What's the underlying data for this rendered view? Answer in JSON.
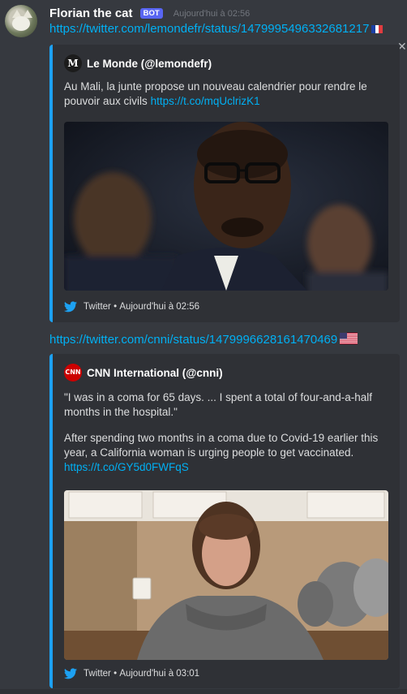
{
  "message": {
    "author": "Florian the cat",
    "bot_tag": "BOT",
    "timestamp": "Aujourd'hui à 02:56"
  },
  "links": [
    {
      "url": "https://twitter.com/lemondefr/status/1479995496332681217",
      "flag": "fr"
    },
    {
      "url": "https://twitter.com/cnni/status/1479996628161470469",
      "flag": "us"
    }
  ],
  "embeds": [
    {
      "author_name": "Le Monde (@lemondefr)",
      "author_icon": "lemonde-logo-icon",
      "author_icon_text": "M",
      "description_text": "Au Mali, la junte propose un nouveau calendrier pour rendre le pouvoir aux civils",
      "description_link": "https://t.co/mqUclrizK1",
      "footer_source": "Twitter",
      "footer_sep": "•",
      "footer_time": "Aujourd'hui à 02:56",
      "accent_color": "#1da1f2"
    },
    {
      "author_name": "CNN International (@cnni)",
      "author_icon": "cnn-logo-icon",
      "author_icon_text": "CNN",
      "description_p1": "\"I was in a coma for 65 days. ... I spent a total of four-and-a-half months in the hospital.\"",
      "description_p2": "After spending two months in a coma due to Covid-19 earlier this year, a California woman is urging people to get vaccinated.",
      "description_link": "https://t.co/GY5d0FWFqS",
      "footer_source": "Twitter",
      "footer_sep": "•",
      "footer_time": "Aujourd'hui à 03:01",
      "accent_color": "#1da1f2"
    }
  ],
  "colors": {
    "background": "#36393f",
    "embed_background": "#2f3136",
    "link": "#00b0f4",
    "bot_tag": "#5865f2",
    "twitter_blue": "#1da1f2"
  }
}
